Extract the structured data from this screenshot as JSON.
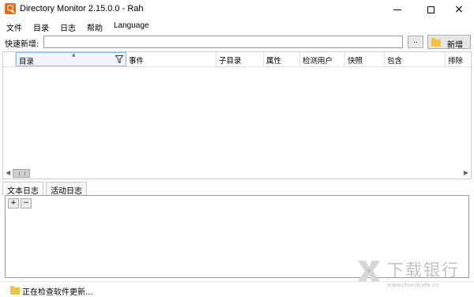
{
  "window": {
    "title": "Directory Monitor 2.15.0.0 - Rah",
    "minimize": "",
    "maximize": "",
    "close": "×"
  },
  "menu": {
    "items": [
      "文件",
      "目录",
      "日志",
      "帮助",
      "Language"
    ]
  },
  "quick_add": {
    "label": "快速新增:",
    "value": "",
    "browse_label": "..",
    "add_label": "新增"
  },
  "grid": {
    "columns": [
      "目录",
      "事件",
      "子目录",
      "属性",
      "检测用户",
      "快照",
      "包含",
      "排除"
    ],
    "sort_arrow": "▲",
    "rows": []
  },
  "tabs": {
    "items": [
      "文本日志",
      "活动日志"
    ],
    "active": 0
  },
  "log": {
    "expand_label": "+",
    "collapse_label": "−"
  },
  "status": {
    "text": "正在检查软件更新..."
  },
  "watermark": {
    "text": "下载银行",
    "url": "www.downbank.cn"
  }
}
